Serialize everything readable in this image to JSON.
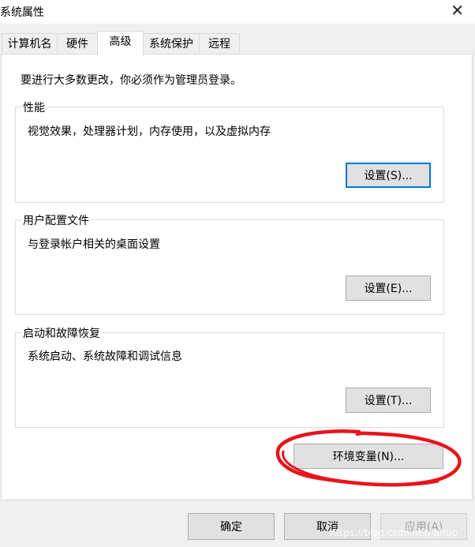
{
  "window": {
    "title": "系统属性",
    "close_glyph": "✕"
  },
  "tabs": [
    {
      "label": "计算机名",
      "active": false
    },
    {
      "label": "硬件",
      "active": false
    },
    {
      "label": "高级",
      "active": true
    },
    {
      "label": "系统保护",
      "active": false
    },
    {
      "label": "远程",
      "active": false
    }
  ],
  "notice": "要进行大多数更改，你必须作为管理员登录。",
  "performance": {
    "title": "性能",
    "desc": "视觉效果，处理器计划，内存使用，以及虚拟内存",
    "button": "设置(S)..."
  },
  "profiles": {
    "title": "用户配置文件",
    "desc": "与登录帐户相关的桌面设置",
    "button": "设置(E)..."
  },
  "startup": {
    "title": "启动和故障恢复",
    "desc": "系统启动、系统故障和调试信息",
    "button": "设置(T)..."
  },
  "env_button": "环境变量(N)...",
  "footer": {
    "ok": "确定",
    "cancel": "取消",
    "apply": "应用(A)"
  },
  "watermark": "https://blog.csdn.net/jahup",
  "colors": {
    "focus": "#0078d7",
    "annotation": "#e8141c"
  }
}
